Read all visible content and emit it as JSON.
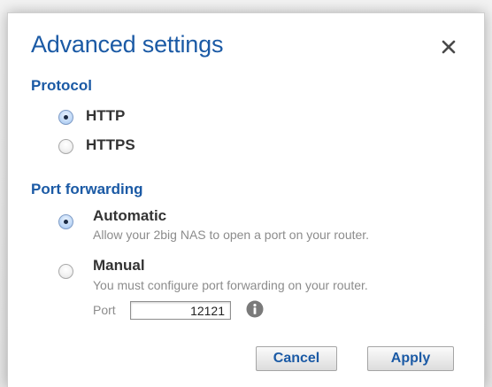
{
  "dialog": {
    "title": "Advanced settings",
    "close_icon": "close-icon"
  },
  "protocol": {
    "heading": "Protocol",
    "options": [
      {
        "label": "HTTP",
        "selected": true
      },
      {
        "label": "HTTPS",
        "selected": false
      }
    ]
  },
  "port_forwarding": {
    "heading": "Port forwarding",
    "options": [
      {
        "label": "Automatic",
        "description": "Allow your 2big NAS to open a port on your router.",
        "selected": true
      },
      {
        "label": "Manual",
        "description": "You must configure port forwarding on your router.",
        "selected": false
      }
    ],
    "port_label": "Port",
    "port_value": "12121",
    "info_icon": "info-icon"
  },
  "buttons": {
    "cancel": "Cancel",
    "apply": "Apply"
  },
  "colors": {
    "accent": "#1b5aa5",
    "label": "#333333",
    "muted": "#8c8c8c"
  }
}
